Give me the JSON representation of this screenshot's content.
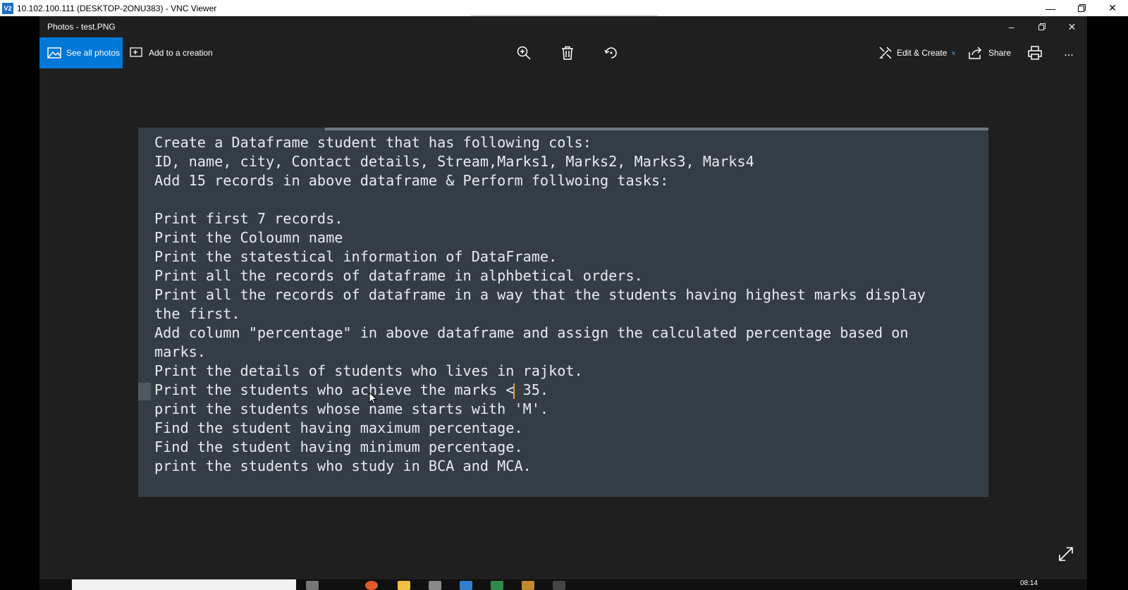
{
  "vnc": {
    "logo": "V2",
    "title": "10.102.100.111 (DESKTOP-2ONU383) - VNC Viewer"
  },
  "photos": {
    "window_title": "Photos - test.PNG",
    "toolbar": {
      "see_all_label": "See all photos",
      "add_creation_label": "Add to a creation",
      "edit_create_label": "Edit & Create",
      "share_label": "Share",
      "more_label": "..."
    },
    "icons": [
      "zoom-in-icon",
      "delete-icon",
      "rotate-icon",
      "print-icon",
      "expand-icon"
    ]
  },
  "picture": {
    "lines": [
      "Create a Dataframe student that has following cols:",
      "ID, name, city, Contact details, Stream,Marks1, Marks2, Marks3, Marks4",
      "Add 15 records in above dataframe & Perform follwoing tasks:",
      "",
      "Print first 7 records.",
      "Print the Coloumn name",
      "Print the statestical information of DataFrame.",
      "Print all the records of dataframe in alphbetical orders.",
      "Print all the records of dataframe in a way that the students having highest marks display",
      "the first.",
      "Add column \"percentage\" in above dataframe and assign the calculated percentage based on",
      "marks.",
      "Print the details of students who lives in rajkot.",
      "Print the students who achieve the marks <",
      "print the students whose name starts with 'M'.",
      "Find the student having maximum percentage.",
      "Find the student having minimum percentage.",
      "print the students who study in BCA and MCA."
    ],
    "caret_line_suffix": " 35."
  },
  "taskbar": {
    "clock": "08:14"
  },
  "colors": {
    "accent": "#0078d7",
    "app_bg": "#1f1f1f",
    "picture_bg": "#343d46",
    "caret": "#f0a030"
  }
}
